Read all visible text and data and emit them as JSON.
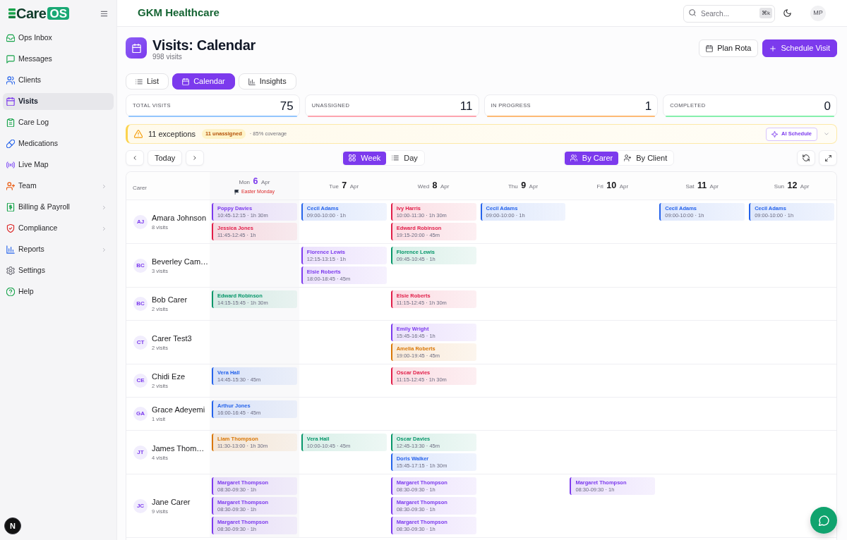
{
  "sidebar": {
    "logo": {
      "text": "Care",
      "badge": "OS"
    },
    "items": [
      {
        "label": "Ops Inbox",
        "selected": false,
        "has_submenu": false
      },
      {
        "label": "Messages",
        "selected": false,
        "has_submenu": false
      },
      {
        "label": "Clients",
        "selected": false,
        "has_submenu": false
      },
      {
        "label": "Visits",
        "selected": true,
        "has_submenu": false
      },
      {
        "label": "Care Log",
        "selected": false,
        "has_submenu": false
      },
      {
        "label": "Medications",
        "selected": false,
        "has_submenu": false
      },
      {
        "label": "Live Map",
        "selected": false,
        "has_submenu": false
      },
      {
        "label": "Team",
        "selected": false,
        "has_submenu": true
      },
      {
        "label": "Billing & Payroll",
        "selected": false,
        "has_submenu": true
      },
      {
        "label": "Compliance",
        "selected": false,
        "has_submenu": true
      },
      {
        "label": "Reports",
        "selected": false,
        "has_submenu": true
      },
      {
        "label": "Settings",
        "selected": false,
        "has_submenu": false
      },
      {
        "label": "Help",
        "selected": false,
        "has_submenu": false
      }
    ]
  },
  "dev_badge": "N",
  "header": {
    "organization": "GKM Healthcare",
    "search": {
      "placeholder": "Search...",
      "shortcut": "⌘k"
    },
    "avatar": "MP"
  },
  "page": {
    "title": "Visits: Calendar",
    "subtitle": "998 visits",
    "actions": [
      {
        "label": "Plan Rota",
        "kind": "secondary"
      },
      {
        "label": "Schedule Visit",
        "kind": "primary"
      }
    ]
  },
  "view_tabs": [
    {
      "label": "List",
      "selected": false
    },
    {
      "label": "Calendar",
      "selected": true
    },
    {
      "label": "Insights",
      "selected": false
    }
  ],
  "stats": [
    {
      "label": "TOTAL VISITS",
      "value": "75",
      "color": "#93c5fd"
    },
    {
      "label": "UNASSIGNED",
      "value": "11",
      "color": "#fda4af"
    },
    {
      "label": "IN PROGRESS",
      "value": "1",
      "color": "#fdba74"
    },
    {
      "label": "COMPLETED",
      "value": "0",
      "color": "#86efac"
    }
  ],
  "exceptions": {
    "title": "11 exceptions",
    "badge": "11 unassigned",
    "note": "· 85% coverage",
    "action": "AI Schedule",
    "expanded": false
  },
  "toolbar": {
    "today": "Today",
    "range_modes": [
      {
        "label": "Week",
        "selected": true
      },
      {
        "label": "Day",
        "selected": false
      }
    ],
    "group_modes": [
      {
        "label": "By Carer",
        "selected": true
      },
      {
        "label": "By Client",
        "selected": false
      }
    ]
  },
  "calendar": {
    "carer_header": "Carer",
    "days": [
      {
        "weekday": "Mon",
        "date": "6",
        "month": "Apr",
        "today": true,
        "holiday": "Easter Monday"
      },
      {
        "weekday": "Tue",
        "date": "7",
        "month": "Apr",
        "today": false
      },
      {
        "weekday": "Wed",
        "date": "8",
        "month": "Apr",
        "today": false
      },
      {
        "weekday": "Thu",
        "date": "9",
        "month": "Apr",
        "today": false
      },
      {
        "weekday": "Fri",
        "date": "10",
        "month": "Apr",
        "today": false
      },
      {
        "weekday": "Sat",
        "date": "11",
        "month": "Apr",
        "today": false
      },
      {
        "weekday": "Sun",
        "date": "12",
        "month": "Apr",
        "today": false
      }
    ],
    "carers": [
      {
        "initials": "AJ",
        "name": "Amara Johnson",
        "count": "8 visits",
        "schedule": {
          "mon": [
            {
              "client": "Poppy Davies",
              "time": "10:45-12:15 · 1h 30m",
              "color": "#7c3aed"
            },
            {
              "client": "Jessica Jones",
              "time": "11:45-12:45 · 1h",
              "color": "#e11d48"
            }
          ],
          "tue": [
            {
              "client": "Cecil Adams",
              "time": "09:00-10:00 · 1h",
              "color": "#2563eb"
            }
          ],
          "wed": [
            {
              "client": "Ivy Harris",
              "time": "10:00-11:30 · 1h 30m",
              "color": "#e11d48"
            },
            {
              "client": "Edward Robinson",
              "time": "19:15-20:00 · 45m",
              "color": "#e11d48"
            }
          ],
          "thu": [
            {
              "client": "Cecil Adams",
              "time": "09:00-10:00 · 1h",
              "color": "#2563eb"
            }
          ],
          "sat": [
            {
              "client": "Cecil Adams",
              "time": "09:00-10:00 · 1h",
              "color": "#2563eb"
            }
          ],
          "sun": [
            {
              "client": "Cecil Adams",
              "time": "09:00-10:00 · 1h",
              "color": "#2563eb"
            }
          ]
        }
      },
      {
        "initials": "BC",
        "name": "Beverley Cam…",
        "count": "3 visits",
        "schedule": {
          "tue": [
            {
              "client": "Florence Lewis",
              "time": "12:15-13:15 · 1h",
              "color": "#7c3aed"
            },
            {
              "client": "Elsie Roberts",
              "time": "18:00-18:45 · 45m",
              "color": "#7c3aed"
            }
          ],
          "wed": [
            {
              "client": "Florence Lewis",
              "time": "09:45-10:45 · 1h",
              "color": "#059669"
            }
          ]
        }
      },
      {
        "initials": "BC",
        "name": "Bob Carer",
        "count": "2 visits",
        "schedule": {
          "mon": [
            {
              "client": "Edward Robinson",
              "time": "14:15-15:45 · 1h 30m",
              "color": "#059669"
            }
          ],
          "wed": [
            {
              "client": "Elsie Roberts",
              "time": "11:15-12:45 · 1h 30m",
              "color": "#e11d48"
            }
          ]
        }
      },
      {
        "initials": "CT",
        "name": "Carer Test3",
        "count": "2 visits",
        "schedule": {
          "wed": [
            {
              "client": "Emily Wright",
              "time": "15:45-16:45 · 1h",
              "color": "#7c3aed"
            },
            {
              "client": "Amelia Roberts",
              "time": "19:00-19:45 · 45m",
              "color": "#d97706"
            }
          ]
        }
      },
      {
        "initials": "CE",
        "name": "Chidi Eze",
        "count": "2 visits",
        "schedule": {
          "mon": [
            {
              "client": "Vera Hall",
              "time": "14:45-15:30 · 45m",
              "color": "#2563eb"
            }
          ],
          "wed": [
            {
              "client": "Oscar Davies",
              "time": "11:15-12:45 · 1h 30m",
              "color": "#e11d48"
            }
          ]
        }
      },
      {
        "initials": "GA",
        "name": "Grace Adeyemi",
        "count": "1 visit",
        "schedule": {
          "mon": [
            {
              "client": "Arthur Jones",
              "time": "16:00-16:45 · 45m",
              "color": "#2563eb"
            }
          ]
        }
      },
      {
        "initials": "JT",
        "name": "James Thom…",
        "count": "4 visits",
        "schedule": {
          "mon": [
            {
              "client": "Liam Thompson",
              "time": "11:30-13:00 · 1h 30m",
              "color": "#d97706"
            }
          ],
          "tue": [
            {
              "client": "Vera Hall",
              "time": "10:00-10:45 · 45m",
              "color": "#059669"
            }
          ],
          "wed": [
            {
              "client": "Oscar Davies",
              "time": "12:45-13:30 · 45m",
              "color": "#059669"
            },
            {
              "client": "Doris Walker",
              "time": "15:45-17:15 · 1h 30m",
              "color": "#2563eb"
            }
          ]
        }
      },
      {
        "initials": "JC",
        "name": "Jane Carer",
        "count": "9 visits",
        "schedule": {
          "mon": [
            {
              "client": "Margaret Thompson",
              "time": "08:30-09:30 · 1h",
              "color": "#7c3aed"
            },
            {
              "client": "Margaret Thompson",
              "time": "08:30-09:30 · 1h",
              "color": "#7c3aed"
            },
            {
              "client": "Margaret Thompson",
              "time": "08:30-09:30 · 1h",
              "color": "#7c3aed"
            }
          ],
          "wed": [
            {
              "client": "Margaret Thompson",
              "time": "08:30-09:30 · 1h",
              "color": "#7c3aed"
            },
            {
              "client": "Margaret Thompson",
              "time": "08:30-09:30 · 1h",
              "color": "#7c3aed"
            },
            {
              "client": "Margaret Thompson",
              "time": "08:30-09:30 · 1h",
              "color": "#7c3aed"
            }
          ],
          "fri": [
            {
              "client": "Margaret Thompson",
              "time": "08:30-09:30 · 1h",
              "color": "#7c3aed"
            }
          ]
        }
      }
    ]
  }
}
